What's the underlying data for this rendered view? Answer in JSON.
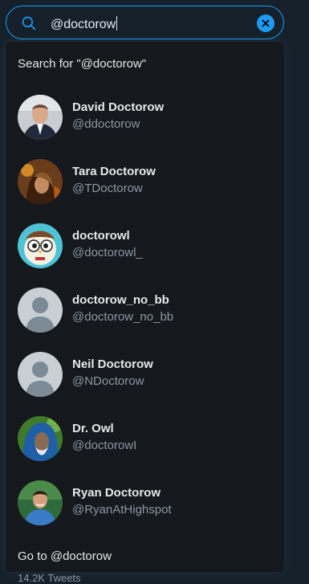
{
  "search": {
    "query": "@doctorow",
    "search_for_text": "Search for \"@doctorow\"",
    "goto_text": "Go to @doctorow"
  },
  "results": [
    {
      "name": "David Doctorow",
      "handle": "@ddoctorow"
    },
    {
      "name": "Tara Doctorow",
      "handle": "@TDoctorow"
    },
    {
      "name": "doctorowl",
      "handle": "@doctorowl_"
    },
    {
      "name": "doctorow_no_bb",
      "handle": "@doctorow_no_bb"
    },
    {
      "name": "Neil Doctorow",
      "handle": "@NDoctorow"
    },
    {
      "name": "Dr. Owl",
      "handle": "@doctorowI"
    },
    {
      "name": "Ryan Doctorow",
      "handle": "@RyanAtHighspot"
    }
  ],
  "background": {
    "partial_text": "14.2K Tweets"
  },
  "colors": {
    "accent": "#1d9bf0",
    "panel": "#15181c",
    "page": "#15202b"
  }
}
